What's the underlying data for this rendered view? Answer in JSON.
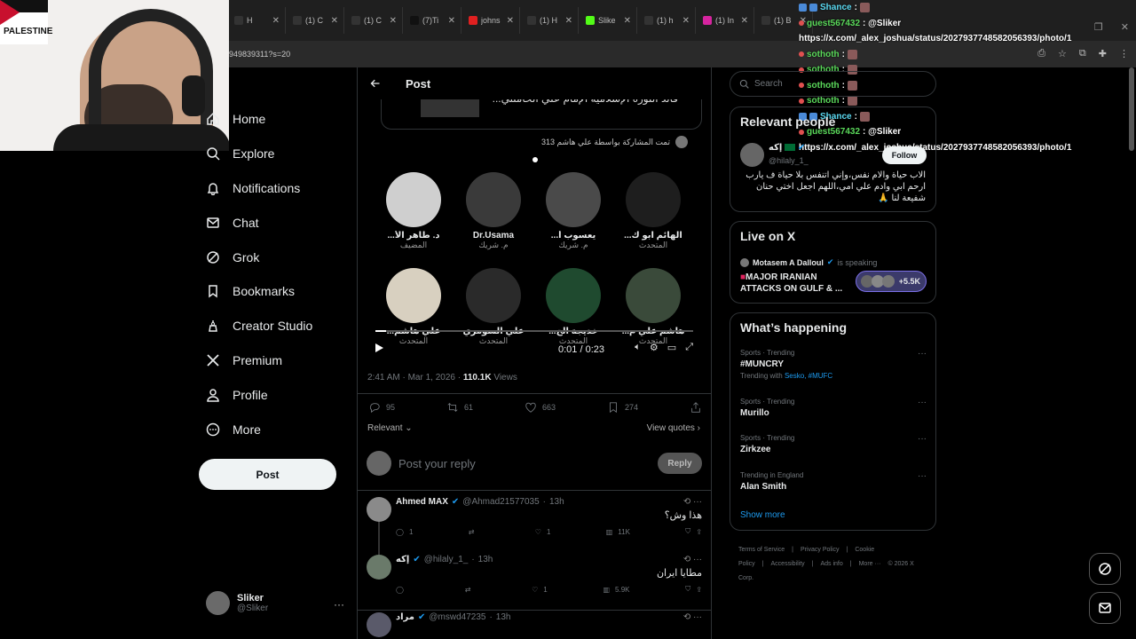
{
  "browser": {
    "tabs": [
      {
        "icon": "x-icon",
        "label": "H",
        "color": "#333"
      },
      {
        "icon": "x-icon",
        "label": "(1) C",
        "color": "#333"
      },
      {
        "icon": "x-icon",
        "label": "(1) C",
        "color": "#333"
      },
      {
        "icon": "tiktok-icon",
        "label": "(7)Ti",
        "color": "#111"
      },
      {
        "icon": "youtube-icon",
        "label": "johns",
        "color": "#e02020"
      },
      {
        "icon": "x-icon",
        "label": "(1) H",
        "color": "#333"
      },
      {
        "icon": "kick-icon",
        "label": "Slike",
        "color": "#53fc18"
      },
      {
        "icon": "x-icon",
        "label": "(1) h",
        "color": "#333"
      },
      {
        "icon": "instagram-icon",
        "label": "(1) In",
        "color": "#d6249f"
      },
      {
        "icon": "x-icon",
        "label": "(1) B",
        "color": "#333"
      }
    ],
    "url": "949839311?s=20"
  },
  "webcam": {
    "flag_label": "PALESTINE"
  },
  "overlay": [
    {
      "user": "Shance",
      "msg": ":",
      "blue": true
    },
    {
      "user": "guest567432",
      "msg": ": @Sliker"
    },
    {
      "user": "",
      "msg": "https://x.com/_alex_joshua/status/2027937748582056393/photo/1"
    },
    {
      "user": "sothoth",
      "msg": ":"
    },
    {
      "user": "sothoth",
      "msg": ":"
    },
    {
      "user": "sothoth",
      "msg": ":"
    },
    {
      "user": "sothoth",
      "msg": ":"
    },
    {
      "user": "Shance",
      "msg": ":",
      "blue": true
    },
    {
      "user": "guest567432",
      "msg": ": @Sliker"
    },
    {
      "user": "",
      "msg": "https://x.com/_alex_joshua/status/2027937748582056393/photo/1"
    }
  ],
  "nav": {
    "items": [
      {
        "label": "Home",
        "icon": "home-icon"
      },
      {
        "label": "Explore",
        "icon": "search-icon"
      },
      {
        "label": "Notifications",
        "icon": "bell-icon"
      },
      {
        "label": "Chat",
        "icon": "mail-icon"
      },
      {
        "label": "Grok",
        "icon": "grok-icon"
      },
      {
        "label": "Bookmarks",
        "icon": "bookmark-icon"
      },
      {
        "label": "Creator Studio",
        "icon": "creator-icon"
      },
      {
        "label": "Premium",
        "icon": "x-logo-icon"
      },
      {
        "label": "Profile",
        "icon": "person-icon"
      },
      {
        "label": "More",
        "icon": "more-circle-icon"
      }
    ],
    "post_label": "Post",
    "account": {
      "name": "Sliker",
      "handle": "@Sliker"
    }
  },
  "post": {
    "header": "Post",
    "quoted_text": "قائد الثورة الإسلامية الإمام علي الخامنئي...",
    "shared_by": "تمت المشاركة بواسطة علي هاشم 313",
    "speakers": [
      {
        "name": "د. طاهر الأ...",
        "role": "المضيف"
      },
      {
        "name": "Dr.Usama",
        "role": "م. شريك"
      },
      {
        "name": "يعسوب أ...",
        "role": "م. شريك"
      },
      {
        "name": "الهائم ابو ك...",
        "role": "المتحدث"
      },
      {
        "name": "علي هاشم...",
        "role": "المتحدث"
      },
      {
        "name": "علي السومري",
        "role": "المتحدث"
      },
      {
        "name": "خديجة الح...",
        "role": "المتحدث"
      },
      {
        "name": "هاشم علي م...",
        "role": "المتحدث"
      }
    ],
    "video_time": "0:01 / 0:23",
    "timestamp": "2:41 AM · Mar 1, 2026 ·",
    "views": "110.1K",
    "views_label": "Views",
    "stats": {
      "replies": "95",
      "reposts": "61",
      "likes": "663",
      "bookmarks": "274"
    },
    "relevant_label": "Relevant",
    "view_quotes": "View quotes",
    "composer_placeholder": "Post your reply",
    "reply_button": "Reply"
  },
  "replies": [
    {
      "name": "Ahmed MAX",
      "handle": "@Ahmad21577035",
      "time": "13h",
      "text": "هذا وش؟",
      "replies": "1",
      "reposts": "",
      "likes": "1",
      "views": "11K"
    },
    {
      "name": "إكه",
      "handle": "@hilaly_1_",
      "time": "13h",
      "text": "مطايا ايران",
      "replies": "",
      "reposts": "",
      "likes": "1",
      "views": "5.9K"
    },
    {
      "name": "مراد",
      "handle": "@mswd47235",
      "time": "13h",
      "text": "",
      "replies": "",
      "reposts": "",
      "likes": "",
      "views": ""
    }
  ],
  "right": {
    "search_placeholder": "Search",
    "relevant_title": "Relevant people",
    "person": {
      "name": "إكه",
      "handle": "@hilaly_1_",
      "follow": "Follow",
      "bio": "الاب حياة والام نفس،وإني اتنفس بلا حياة ف يارب ارحم ابي وادم علي امي،اللهم اجعل اختي حنان شفيعة لنا 🙏"
    },
    "live_title": "Live on X",
    "live": {
      "host": "Motasem A Dalloul",
      "status": "is speaking",
      "title": "MAJOR IRANIAN ATTACKS ON GULF & ...",
      "count": "+5.5K"
    },
    "happening_title": "What’s happening",
    "trends": [
      {
        "context": "Sports · Trending",
        "name": "#MUNCRY",
        "with_label": "Trending with",
        "with": "Sesko, #MUFC"
      },
      {
        "context": "Sports · Trending",
        "name": "Murillo"
      },
      {
        "context": "Sports · Trending",
        "name": "Zirkzee"
      },
      {
        "context": "Trending in England",
        "name": "Alan Smith"
      }
    ],
    "show_more": "Show more",
    "footer": [
      "Terms of Service",
      "|",
      "Privacy Policy",
      "|",
      "Cookie Policy",
      "|",
      "Accessibility",
      "|",
      "Ads info",
      "|",
      "More ···",
      "© 2026 X Corp."
    ]
  }
}
